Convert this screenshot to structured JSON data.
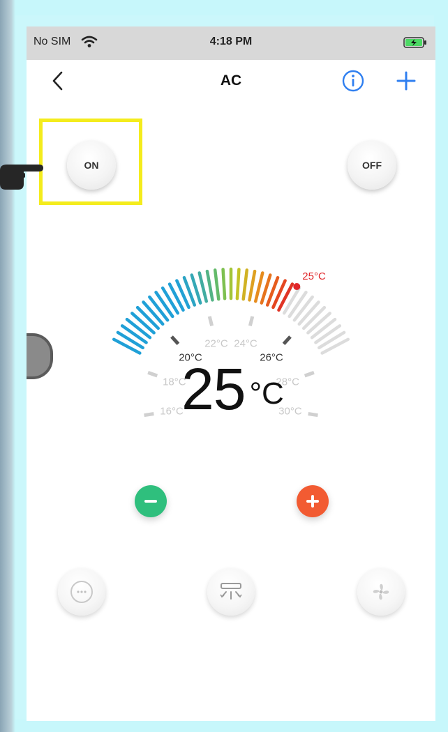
{
  "status_bar": {
    "carrier": "No SIM",
    "time": "4:18 PM",
    "wifi_icon": "wifi-icon",
    "battery_icon": "battery-charging-icon"
  },
  "nav": {
    "title": "AC",
    "back_icon": "chevron-left-icon",
    "info_icon": "info-icon",
    "add_icon": "plus-icon",
    "accent_color": "#2f7ff0"
  },
  "power": {
    "on_label": "ON",
    "off_label": "OFF",
    "highlight_color": "#f4ec1d"
  },
  "dial": {
    "current_temp": "25",
    "unit": "°C",
    "setpoint_label": "25°C",
    "min": 16,
    "max": 30,
    "setpoint": 25,
    "labels": [
      "16°C",
      "18°C",
      "20°C",
      "22°C",
      "24°C",
      "26°C",
      "28°C",
      "30°C"
    ]
  },
  "controls": {
    "decrease_icon": "minus-icon",
    "increase_icon": "plus-icon",
    "decrease_color": "#2fbf7d",
    "increase_color": "#f25b32"
  },
  "modes": [
    {
      "icon": "mode-icon"
    },
    {
      "icon": "swing-icon"
    },
    {
      "icon": "fan-icon"
    }
  ]
}
